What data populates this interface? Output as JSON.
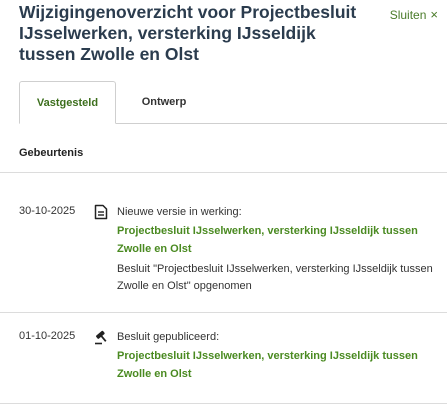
{
  "panel": {
    "title": "Wijzigingenoverzicht voor Projectbesluit IJsselwerken, versterking IJsseldijk tussen Zwolle en Olst",
    "close_label": "Sluiten",
    "close_glyph": "×"
  },
  "tabs": [
    {
      "label": "Vastgesteld",
      "active": true
    },
    {
      "label": "Ontwerp",
      "active": false
    }
  ],
  "section": {
    "heading": "Gebeurtenis"
  },
  "events": [
    {
      "date": "30-10-2025",
      "icon": "document-icon",
      "text": "Nieuwe versie in werking:",
      "link": "Projectbesluit IJsselwerken, versterking IJsseldijk tussen Zwolle en Olst",
      "description": "Besluit \"Projectbesluit IJsselwerken, versterking IJsseldijk tussen Zwolle en Olst\" opgenomen"
    },
    {
      "date": "01-10-2025",
      "icon": "gavel-icon",
      "text": "Besluit gepubliceerd:",
      "link": "Projectbesluit IJsselwerken, versterking IJsseldijk tussen Zwolle en Olst"
    }
  ],
  "colors": {
    "accent": "#4a8a21",
    "title": "#2b3c4e"
  }
}
